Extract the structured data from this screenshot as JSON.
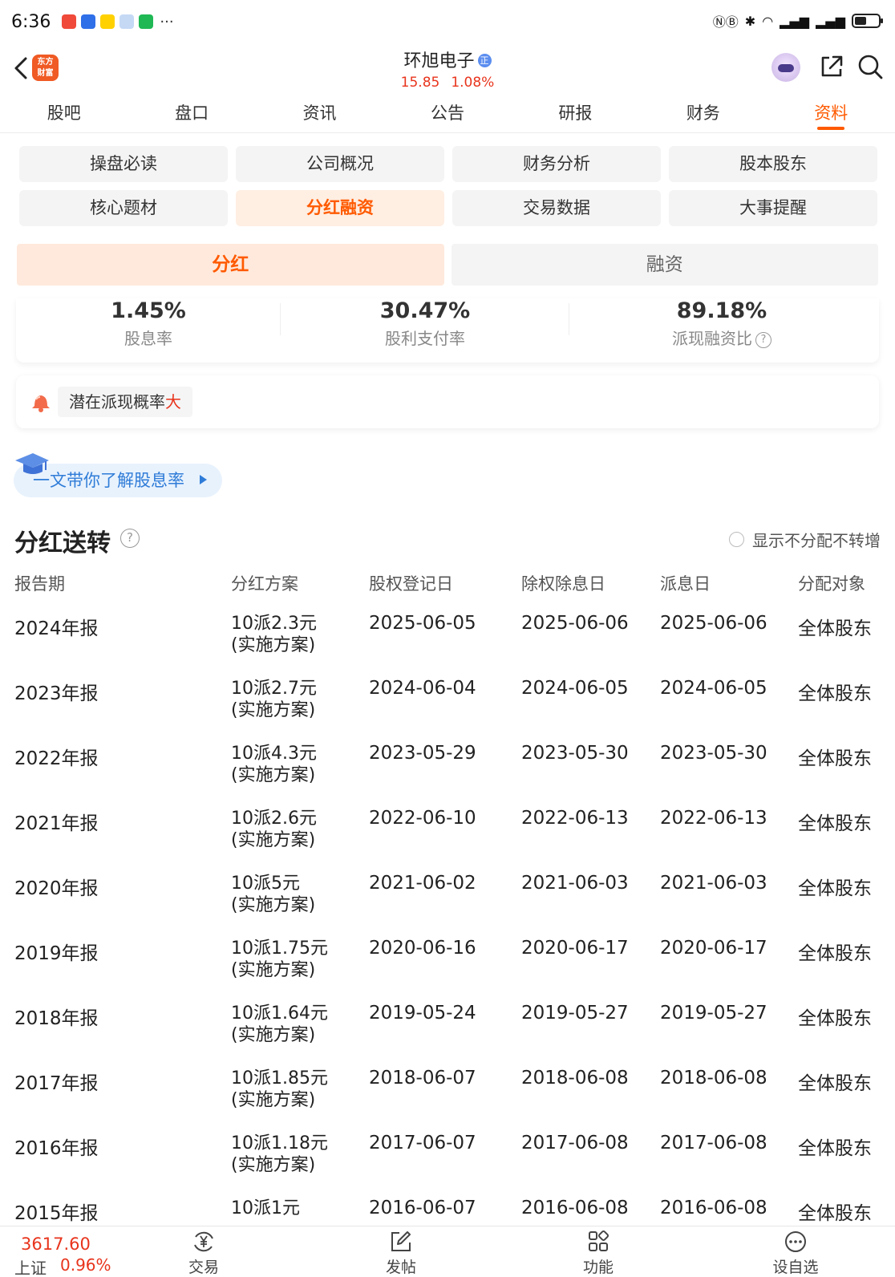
{
  "status": {
    "time": "6:36",
    "more": "···",
    "app_icons": [
      {
        "name": "notification-app-icon",
        "color": "#f04a3a"
      },
      {
        "name": "browser-app-icon",
        "color": "#2f6fe8"
      },
      {
        "name": "meituan-app-icon",
        "color": "#ffd100"
      },
      {
        "name": "colorful-app-icon",
        "color": "#c5d9f5"
      },
      {
        "name": "wechat-app-icon",
        "color": "#1fb855"
      }
    ]
  },
  "header": {
    "stock_name": "环旭电子",
    "badge": "正",
    "price": "15.85",
    "change_pct": "1.08%",
    "logo_text": "东方财富"
  },
  "tabs": [
    {
      "label": "股吧",
      "active": false
    },
    {
      "label": "盘口",
      "active": false
    },
    {
      "label": "资讯",
      "active": false
    },
    {
      "label": "公告",
      "active": false
    },
    {
      "label": "研报",
      "active": false
    },
    {
      "label": "财务",
      "active": false
    },
    {
      "label": "资料",
      "active": true
    }
  ],
  "subnav": [
    {
      "label": "操盘必读",
      "active": false
    },
    {
      "label": "公司概况",
      "active": false
    },
    {
      "label": "财务分析",
      "active": false
    },
    {
      "label": "股本股东",
      "active": false
    },
    {
      "label": "核心题材",
      "active": false
    },
    {
      "label": "分红融资",
      "active": true
    },
    {
      "label": "交易数据",
      "active": false
    },
    {
      "label": "大事提醒",
      "active": false
    }
  ],
  "segments": [
    {
      "label": "分红",
      "active": true
    },
    {
      "label": "融资",
      "active": false
    }
  ],
  "stats": [
    {
      "value": "1.45%",
      "label": "股息率"
    },
    {
      "value": "30.47%",
      "label": "股利支付率"
    },
    {
      "value": "89.18%",
      "label": "派现融资比"
    }
  ],
  "potential": {
    "prefix": "潜在派现概率",
    "level": "大"
  },
  "guide": {
    "text": "一文带你了解股息率"
  },
  "section": {
    "title": "分红送转",
    "filter_label": "显示不分配不转增"
  },
  "table": {
    "headers": [
      "报告期",
      "分红方案",
      "股权登记日",
      "除权除息日",
      "派息日",
      "分配对象"
    ],
    "rows": [
      {
        "period": "2024年报",
        "plan": "10派2.3元",
        "note": "(实施方案)",
        "record": "2025-06-05",
        "exdiv": "2025-06-06",
        "pay": "2025-06-06",
        "target": "全体股东"
      },
      {
        "period": "2023年报",
        "plan": "10派2.7元",
        "note": "(实施方案)",
        "record": "2024-06-04",
        "exdiv": "2024-06-05",
        "pay": "2024-06-05",
        "target": "全体股东"
      },
      {
        "period": "2022年报",
        "plan": "10派4.3元",
        "note": "(实施方案)",
        "record": "2023-05-29",
        "exdiv": "2023-05-30",
        "pay": "2023-05-30",
        "target": "全体股东"
      },
      {
        "period": "2021年报",
        "plan": "10派2.6元",
        "note": "(实施方案)",
        "record": "2022-06-10",
        "exdiv": "2022-06-13",
        "pay": "2022-06-13",
        "target": "全体股东"
      },
      {
        "period": "2020年报",
        "plan": "10派5元",
        "note": "(实施方案)",
        "record": "2021-06-02",
        "exdiv": "2021-06-03",
        "pay": "2021-06-03",
        "target": "全体股东"
      },
      {
        "period": "2019年报",
        "plan": "10派1.75元",
        "note": "(实施方案)",
        "record": "2020-06-16",
        "exdiv": "2020-06-17",
        "pay": "2020-06-17",
        "target": "全体股东"
      },
      {
        "period": "2018年报",
        "plan": "10派1.64元",
        "note": "(实施方案)",
        "record": "2019-05-24",
        "exdiv": "2019-05-27",
        "pay": "2019-05-27",
        "target": "全体股东"
      },
      {
        "period": "2017年报",
        "plan": "10派1.85元",
        "note": "(实施方案)",
        "record": "2018-06-07",
        "exdiv": "2018-06-08",
        "pay": "2018-06-08",
        "target": "全体股东"
      },
      {
        "period": "2016年报",
        "plan": "10派1.18元",
        "note": "(实施方案)",
        "record": "2017-06-07",
        "exdiv": "2017-06-08",
        "pay": "2017-06-08",
        "target": "全体股东"
      },
      {
        "period": "2015年报",
        "plan": "10派1元",
        "note": "",
        "record": "2016-06-07",
        "exdiv": "2016-06-08",
        "pay": "2016-06-08",
        "target": "全体股东"
      }
    ]
  },
  "bottom": {
    "index_value": "3617.60",
    "index_name": "上证",
    "index_change": "0.96%",
    "nav": [
      {
        "label": "交易",
        "icon": "yuan-exchange-icon"
      },
      {
        "label": "发帖",
        "icon": "edit-icon"
      },
      {
        "label": "功能",
        "icon": "grid-icon"
      },
      {
        "label": "设自选",
        "icon": "more-circle-icon"
      }
    ]
  },
  "colors": {
    "accent": "#ff5a00",
    "up": "#e8341c",
    "link": "#2f7cd8"
  }
}
